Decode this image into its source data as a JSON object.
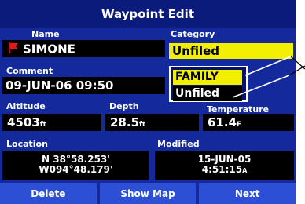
{
  "title": "Waypoint Edit",
  "name": {
    "label": "Name",
    "value": "SIMONE",
    "icon": "red-flag-icon"
  },
  "category": {
    "label": "Category",
    "value": "Unfiled",
    "options": [
      "FAMILY",
      "Unfiled"
    ]
  },
  "comment": {
    "label": "Comment",
    "value": "09-JUN-06 09:50"
  },
  "altitude": {
    "label": "Altitude",
    "value": "4503",
    "unit": "ft"
  },
  "depth": {
    "label": "Depth",
    "value": "28.5",
    "unit": "ft"
  },
  "temperature": {
    "label": "Temperature",
    "value": "61.4",
    "unit": "F"
  },
  "location": {
    "label": "Location",
    "lat": "N  38°58.253'",
    "lon": "W094°48.179'"
  },
  "modified": {
    "label": "Modified",
    "date": "15-JUN-05",
    "time": "4:51:15",
    "time_suffix": "A"
  },
  "buttons": {
    "delete": "Delete",
    "show_map": "Show Map",
    "next": "Next"
  },
  "colors": {
    "background": "#142a9c",
    "highlight": "#f2f000",
    "button": "#2c4fd6",
    "field": "#000000"
  }
}
